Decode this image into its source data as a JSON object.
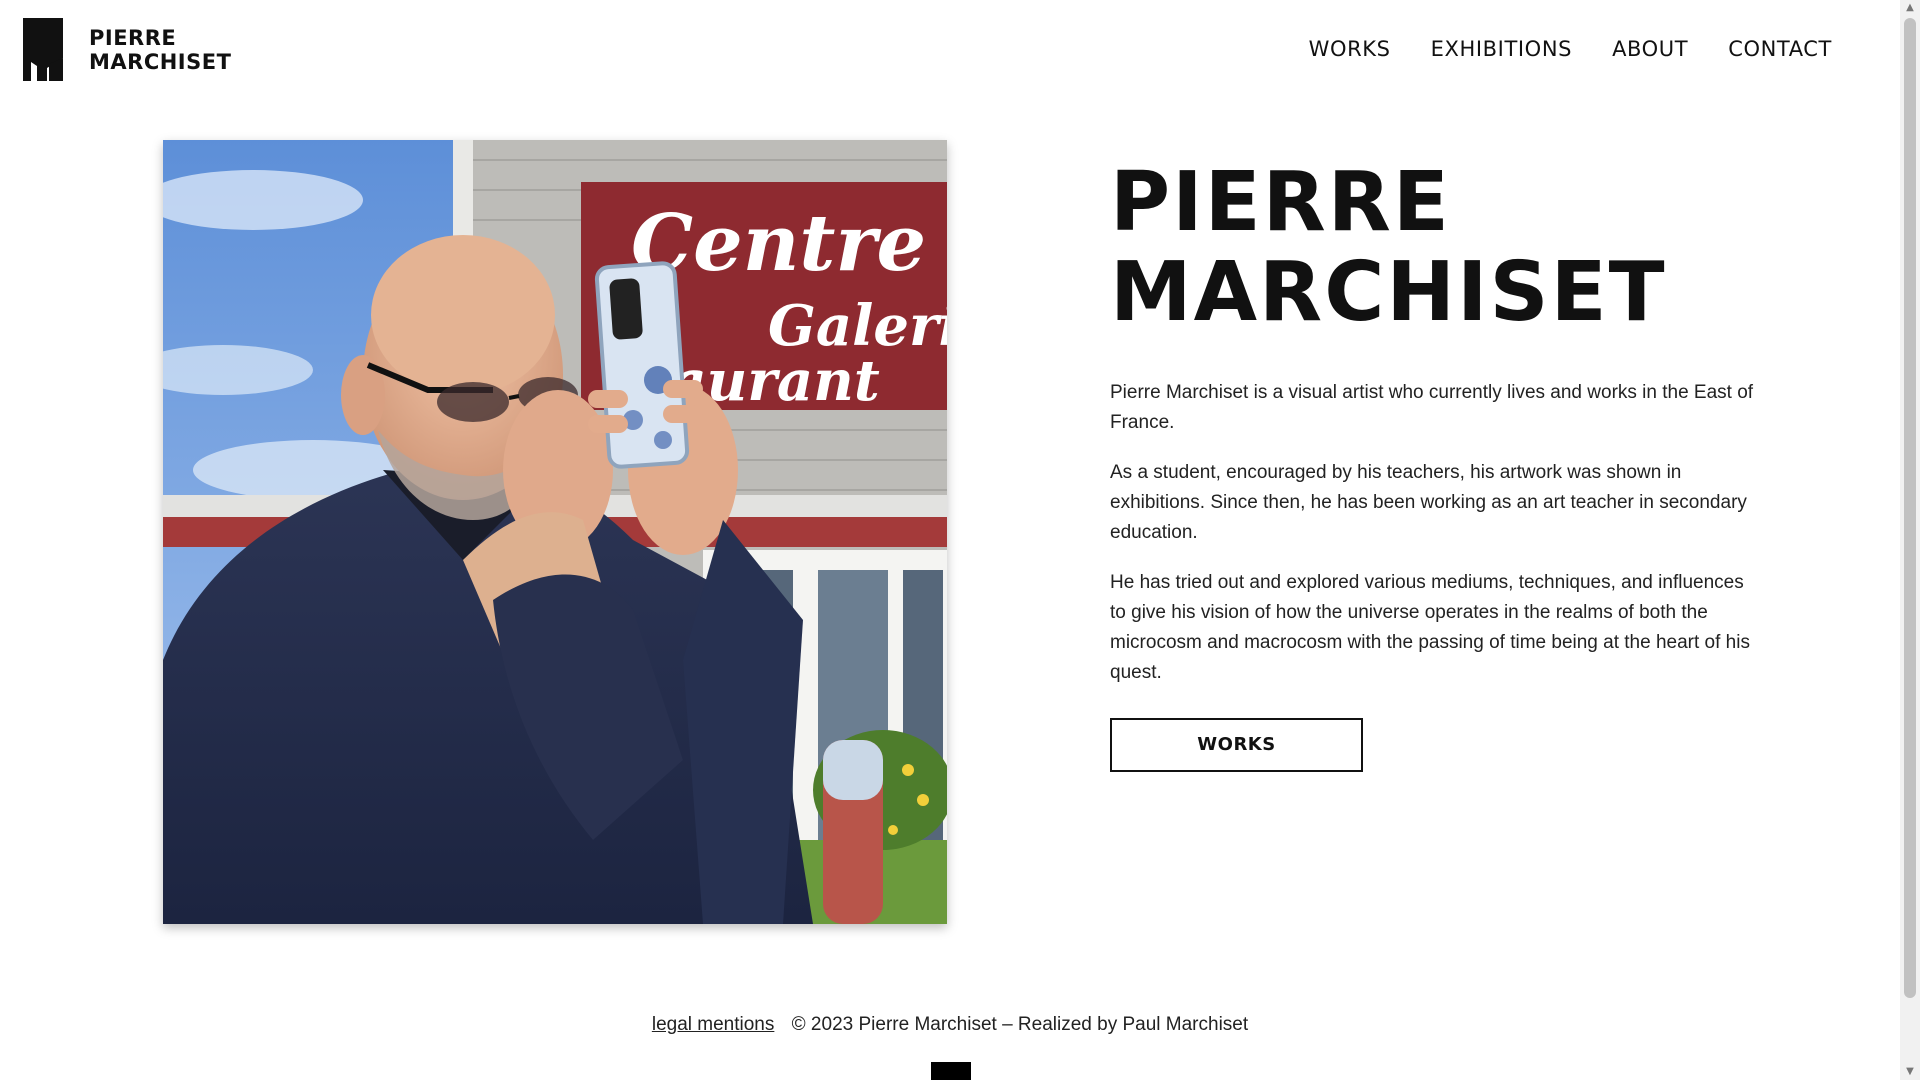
{
  "header": {
    "logo_line1": "PIERRE",
    "logo_line2": "MARCHISET",
    "nav": [
      "WORKS",
      "EXHIBITIONS",
      "ABOUT",
      "CONTACT"
    ]
  },
  "portrait": {
    "sign_line1": "Centre d'Art",
    "sign_line2": "Galerie",
    "sign_line3": "staurant"
  },
  "bio": {
    "title_line1": "PIERRE",
    "title_line2": "MARCHISET",
    "paragraphs": [
      "Pierre Marchiset is a visual artist who currently lives and works in the East of France.",
      "As a student, encouraged by his teachers, his artwork was shown in exhibitions. Since then, he has been working as an art teacher in secondary education.",
      "He has tried out and explored various mediums, techniques, and influences to give his vision of how the universe operates in the realms of both the microcosm and macrocosm with the passing of time being at the heart of his quest."
    ],
    "button_label": "WORKS"
  },
  "footer": {
    "legal_link": "legal mentions",
    "copyright": "© 2023 Pierre Marchiset – Realized by Paul Marchiset"
  },
  "colors": {
    "text": "#111111",
    "background": "#ffffff",
    "sign_red": "#8e2a30"
  }
}
